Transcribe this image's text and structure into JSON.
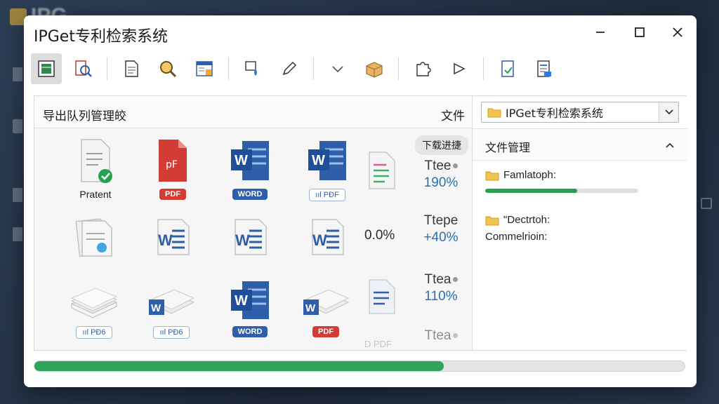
{
  "background": {
    "app_title": "IPG"
  },
  "window": {
    "title": "IPGet专利检索系统",
    "controls": {
      "minimize": "minimize-icon",
      "maximize": "maximize-icon",
      "close": "close-icon"
    }
  },
  "toolbar": {
    "buttons": [
      "document-grid-icon",
      "search-document-icon",
      "page-icon",
      "magnifier-icon",
      "calendar-table-icon",
      "drop-tool-icon",
      "edit-pen-icon",
      "chevron-down-icon",
      "package-box-icon",
      "puzzle-icon",
      "play-arrow-icon",
      "export-doc-icon",
      "notes-doc-icon"
    ]
  },
  "queue": {
    "title": "导出队列管理皎",
    "file_label": "文件",
    "speed_badge": "下载进捷",
    "files": [
      {
        "type": "generic-check",
        "caption": "Pratent"
      },
      {
        "type": "pdf",
        "badge": "PDF"
      },
      {
        "type": "word",
        "badge": "WORD"
      },
      {
        "type": "word",
        "badge": "ııl PÐF"
      },
      {
        "type": "doc-plain"
      },
      {
        "type": "word-doc"
      },
      {
        "type": "word-doc"
      },
      {
        "type": "word-doc"
      },
      {
        "type": "stack"
      },
      {
        "type": "stack-word"
      },
      {
        "type": "word-stack"
      },
      {
        "type": "stack-word"
      }
    ],
    "row3_badges": [
      "ııl PÐ6",
      "ııl PÐ6",
      "WORD",
      "PDF"
    ],
    "stats": [
      {
        "label": "Ttee",
        "value": "190%"
      },
      {
        "label": "Ttepe",
        "value": "+40%"
      },
      {
        "label": "Ttea",
        "value": "110%"
      },
      {
        "label": "Ttea",
        "value": ""
      }
    ],
    "plain_percent": "0.0%",
    "partial_text": "D PDF"
  },
  "folder_select": {
    "value": "IPGet专利检索系统"
  },
  "file_manager": {
    "title": "文件管理",
    "items": [
      {
        "name": "Famlatoph:",
        "progress": 0.6
      },
      {
        "name": "\"Dectrtoh:"
      }
    ],
    "commerce_text": "Commelrioin:"
  },
  "overall_progress": 0.63,
  "colors": {
    "accent_green": "#2ea55a",
    "word_blue": "#2e5fa8",
    "pdf_red": "#d33c34",
    "folder_yellow": "#f2c14e"
  }
}
